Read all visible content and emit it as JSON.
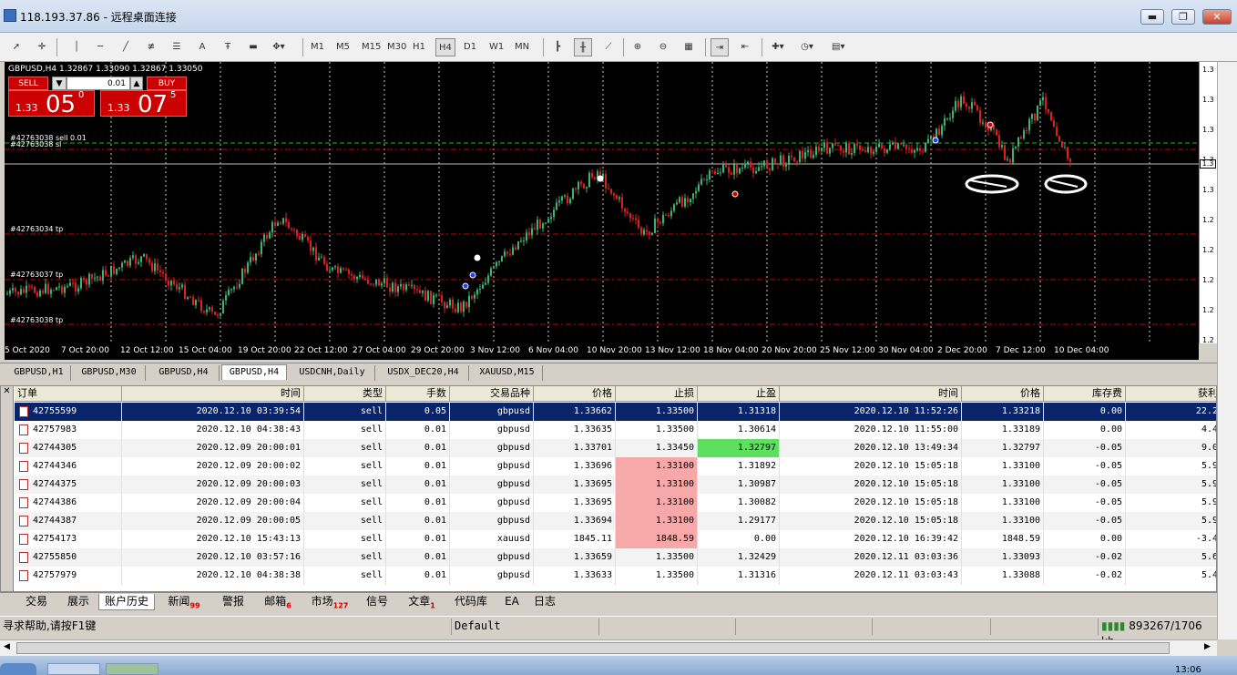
{
  "window": {
    "title": "118.193.37.86 - 远程桌面连接",
    "minimize": "▬",
    "maximize": "❐",
    "close": "✕"
  },
  "toolbar": {
    "timeframes": [
      "M1",
      "M5",
      "M15",
      "M30",
      "H1",
      "H4",
      "D1",
      "W1",
      "MN"
    ],
    "active_timeframe": "H4"
  },
  "chart": {
    "header": "GBPUSD,H4  1.32867 1.33090 1.32867 1.33050",
    "sell_label": "SELL",
    "buy_label": "BUY",
    "lot": "0.01",
    "sell_price": {
      "prefix": "1.33",
      "big": "05",
      "sup": "0"
    },
    "buy_price": {
      "prefix": "1.33",
      "big": "07",
      "sup": "5"
    },
    "order_labels": [
      "#42763038 sell 0.01",
      "#42763038 sl",
      "#42763034 tp",
      "#42763037 tp",
      "#42763038 tp"
    ],
    "price_ticks": [
      "1.3",
      "1.3",
      "1.3",
      "1.3",
      "1.3",
      "1.2",
      "1.2",
      "1.2",
      "1.2",
      "1.2",
      "1.2"
    ],
    "current_price_tag": "1.3",
    "time_labels": [
      "5 Oct 2020",
      "7 Oct 20:00",
      "12 Oct 12:00",
      "15 Oct 04:00",
      "19 Oct 20:00",
      "22 Oct 12:00",
      "27 Oct 04:00",
      "29 Oct 20:00",
      "3 Nov 12:00",
      "6 Nov 04:00",
      "10 Nov 20:00",
      "13 Nov 12:00",
      "18 Nov 04:00",
      "20 Nov 20:00",
      "25 Nov 12:00",
      "30 Nov 04:00",
      "2 Dec 20:00",
      "7 Dec 12:00",
      "10 Dec 04:00"
    ],
    "bull_color": "#3cb371",
    "bear_color": "#dc2020"
  },
  "chart_tabs": [
    "GBPUSD,H1",
    "GBPUSD,M30",
    "GBPUSD,H4",
    "GBPUSD,H4",
    "USDCNH,Daily",
    "USDX_DEC20,H4",
    "XAUUSD,M15"
  ],
  "chart_tab_active": 3,
  "history": {
    "columns": [
      "订单",
      "时间",
      "类型",
      "手数",
      "交易品种",
      "价格",
      "止损",
      "止盈",
      "时间",
      "价格",
      "库存费",
      "获利"
    ],
    "rows": [
      [
        "42755599",
        "2020.12.10 03:39:54",
        "sell",
        "0.05",
        "gbpusd",
        "1.33662",
        "1.33500",
        "1.31318",
        "2020.12.10 11:52:26",
        "1.33218",
        "0.00",
        "22.2"
      ],
      [
        "42757983",
        "2020.12.10 04:38:43",
        "sell",
        "0.01",
        "gbpusd",
        "1.33635",
        "1.33500",
        "1.30614",
        "2020.12.10 11:55:00",
        "1.33189",
        "0.00",
        "4.4"
      ],
      [
        "42744305",
        "2020.12.09 20:00:01",
        "sell",
        "0.01",
        "gbpusd",
        "1.33701",
        "1.33450",
        "1.32797",
        "2020.12.10 13:49:34",
        "1.32797",
        "-0.05",
        "9.0"
      ],
      [
        "42744346",
        "2020.12.09 20:00:02",
        "sell",
        "0.01",
        "gbpusd",
        "1.33696",
        "1.33100",
        "1.31892",
        "2020.12.10 15:05:18",
        "1.33100",
        "-0.05",
        "5.9"
      ],
      [
        "42744375",
        "2020.12.09 20:00:03",
        "sell",
        "0.01",
        "gbpusd",
        "1.33695",
        "1.33100",
        "1.30987",
        "2020.12.10 15:05:18",
        "1.33100",
        "-0.05",
        "5.9"
      ],
      [
        "42744386",
        "2020.12.09 20:00:04",
        "sell",
        "0.01",
        "gbpusd",
        "1.33695",
        "1.33100",
        "1.30082",
        "2020.12.10 15:05:18",
        "1.33100",
        "-0.05",
        "5.9"
      ],
      [
        "42744387",
        "2020.12.09 20:00:05",
        "sell",
        "0.01",
        "gbpusd",
        "1.33694",
        "1.33100",
        "1.29177",
        "2020.12.10 15:05:18",
        "1.33100",
        "-0.05",
        "5.9"
      ],
      [
        "42754173",
        "2020.12.10 15:43:13",
        "sell",
        "0.01",
        "xauusd",
        "1845.11",
        "1848.59",
        "0.00",
        "2020.12.10 16:39:42",
        "1848.59",
        "0.00",
        "-3.4"
      ],
      [
        "42755850",
        "2020.12.10 03:57:16",
        "sell",
        "0.01",
        "gbpusd",
        "1.33659",
        "1.33500",
        "1.32429",
        "2020.12.11 03:03:36",
        "1.33093",
        "-0.02",
        "5.6"
      ],
      [
        "42757979",
        "2020.12.10 04:38:38",
        "sell",
        "0.01",
        "gbpusd",
        "1.33633",
        "1.33500",
        "1.31316",
        "2020.12.11 03:03:43",
        "1.33088",
        "-0.02",
        "5.4"
      ]
    ]
  },
  "bottom_tabs": [
    {
      "label": "交易",
      "badge": ""
    },
    {
      "label": "展示",
      "badge": ""
    },
    {
      "label": "账户历史",
      "badge": ""
    },
    {
      "label": "新闻",
      "badge": "99"
    },
    {
      "label": "警报",
      "badge": ""
    },
    {
      "label": "邮箱",
      "badge": "6"
    },
    {
      "label": "市场",
      "badge": "127"
    },
    {
      "label": "信号",
      "badge": ""
    },
    {
      "label": "文章",
      "badge": "1"
    },
    {
      "label": "代码库",
      "badge": ""
    },
    {
      "label": "EA",
      "badge": ""
    },
    {
      "label": "日志",
      "badge": ""
    }
  ],
  "bottom_tab_active": 2,
  "status": {
    "help": "寻求帮助,请按F1键",
    "profile": "Default",
    "traffic": "893267/1706 kb"
  },
  "taskbar": {
    "clock": "13:06"
  }
}
